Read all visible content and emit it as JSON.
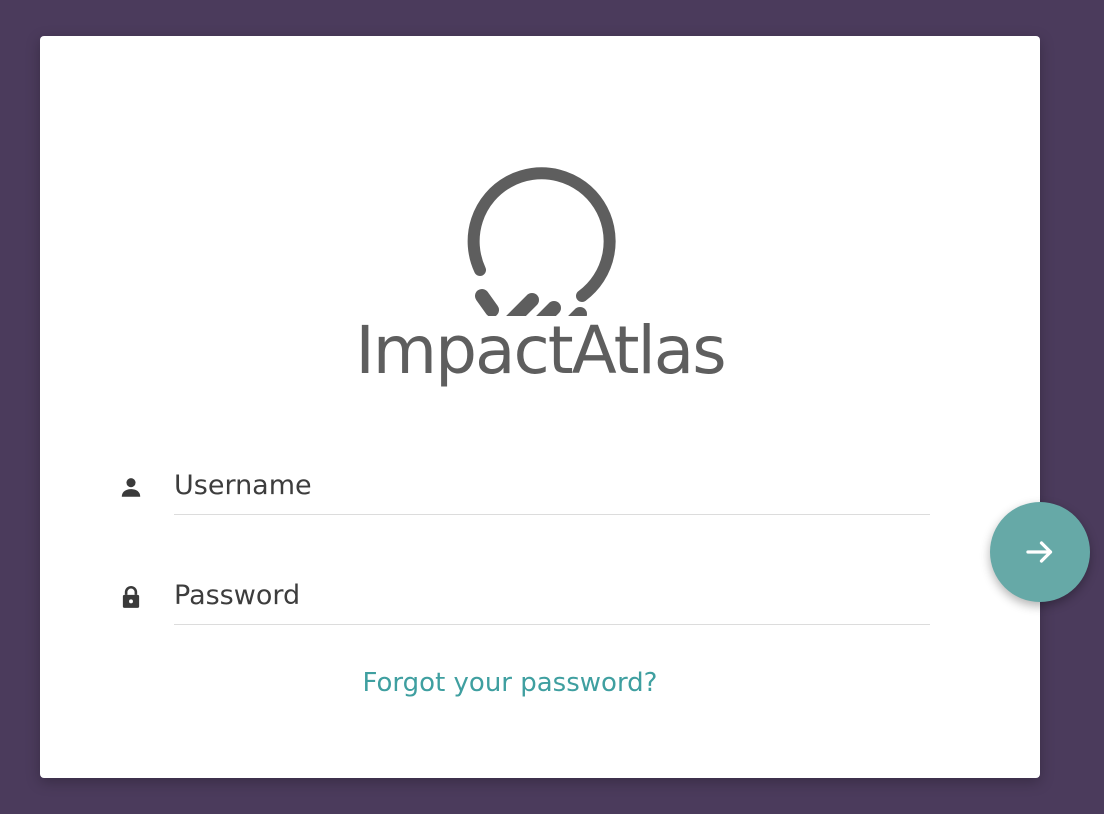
{
  "brand": {
    "name": "ImpactAtlas",
    "logo_color": "#5e5e5e"
  },
  "login": {
    "username_placeholder": "Username",
    "password_placeholder": "Password",
    "forgot_password_text": "Forgot your password?",
    "submit_icon": "arrow-right-icon"
  },
  "colors": {
    "background": "#4b3b5c",
    "card": "#ffffff",
    "accent": "#66a9a7",
    "link": "#3f9fa0"
  }
}
